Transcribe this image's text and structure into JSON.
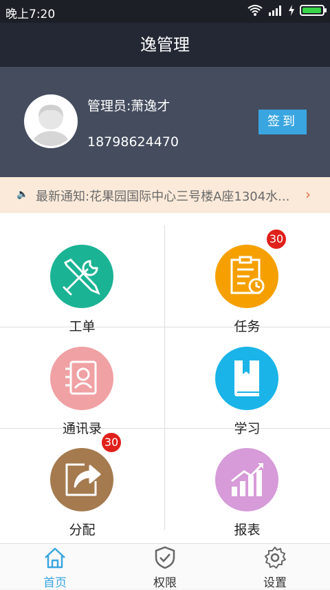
{
  "status_bar": {
    "time": "晚上7:20",
    "battery_level": 0.95
  },
  "header": {
    "title": "逸管理"
  },
  "profile": {
    "name": "管理员:萧逸才",
    "phone": "18798624470",
    "checkin_label": "签到"
  },
  "notice": {
    "text": "最新通知:花果园国际中心三号楼A座1304水...",
    "icon": "speaker-icon",
    "arrow": "›"
  },
  "grid": {
    "items": [
      {
        "label": "工单",
        "icon": "tools-icon",
        "color": "#1ab394",
        "badge": ""
      },
      {
        "label": "任务",
        "icon": "clipboard-clock-icon",
        "color": "#f5a000",
        "badge": "30"
      },
      {
        "label": "通讯录",
        "icon": "contact-icon",
        "color": "#f0a1a4",
        "badge": ""
      },
      {
        "label": "学习",
        "icon": "book-icon",
        "color": "#1ab4e8",
        "badge": ""
      },
      {
        "label": "分配",
        "icon": "share-icon",
        "color": "#a47a4e",
        "badge": "30"
      },
      {
        "label": "报表",
        "icon": "chart-icon",
        "color": "#d69bd8",
        "badge": ""
      }
    ]
  },
  "tabbar": {
    "active_color": "#3aa6e1",
    "items": [
      {
        "label": "首页",
        "icon": "home-icon"
      },
      {
        "label": "权限",
        "icon": "shield-icon"
      },
      {
        "label": "设置",
        "icon": "gear-icon"
      }
    ]
  }
}
